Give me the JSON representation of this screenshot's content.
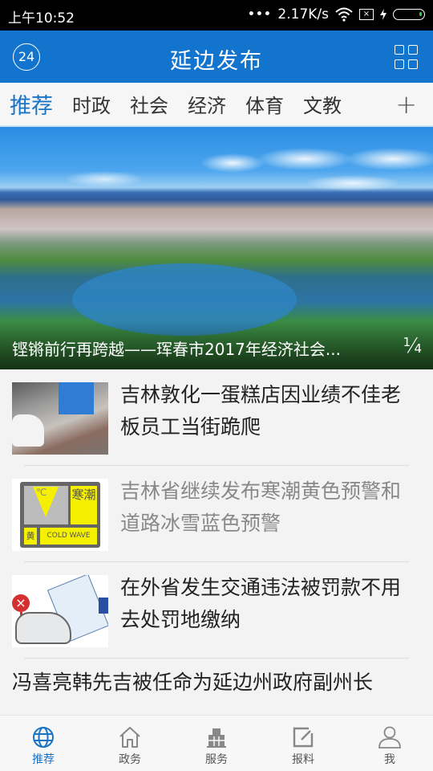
{
  "status_bar": {
    "time": "上午10:52",
    "network_speed": "2.17K/s",
    "signal_dots": "•••",
    "icons": [
      "wifi-icon",
      "sim-error-icon",
      "charging-icon",
      "battery-icon"
    ]
  },
  "app_bar": {
    "title": "延边发布",
    "left_badge": "24",
    "right_icon": "grid-menu-icon"
  },
  "tabs": {
    "items": [
      {
        "label": "推荐",
        "active": true
      },
      {
        "label": "时政",
        "active": false
      },
      {
        "label": "社会",
        "active": false
      },
      {
        "label": "经济",
        "active": false
      },
      {
        "label": "体育",
        "active": false
      },
      {
        "label": "文教",
        "active": false
      }
    ],
    "add_label": "+"
  },
  "hero": {
    "caption": "铿锵前行再跨越——珲春市2017年经济社会...",
    "page_current": "1",
    "page_total": "4"
  },
  "news": [
    {
      "title": "吉林敦化一蛋糕店因业绩不佳老板员工当街跪爬",
      "read": false,
      "thumb": "street-photo"
    },
    {
      "title": "吉林省继续发布寒潮黄色预警和道路冰雪蓝色预警",
      "read": true,
      "thumb": "cold-wave-warning",
      "thumb_text": {
        "degree": "℃",
        "side": "寒潮",
        "level": "黄",
        "label": "COLD WAVE"
      }
    },
    {
      "title": "在外省发生交通违法被罚款不用去处罚地缴纳",
      "read": false,
      "thumb": "traffic-fine-cartoon"
    },
    {
      "title": "冯喜亮韩先吉被任命为延边州政府副州长",
      "read": false
    }
  ],
  "bottom_nav": [
    {
      "label": "推荐",
      "icon": "globe-icon",
      "active": true
    },
    {
      "label": "政务",
      "icon": "home-icon",
      "active": false
    },
    {
      "label": "服务",
      "icon": "building-icon",
      "active": false
    },
    {
      "label": "报料",
      "icon": "edit-icon",
      "active": false
    },
    {
      "label": "我",
      "icon": "user-icon",
      "active": false
    }
  ],
  "colors": {
    "primary": "#1274cc",
    "tab_active": "#1a74c6",
    "text": "#222222",
    "text_read": "#888888"
  }
}
